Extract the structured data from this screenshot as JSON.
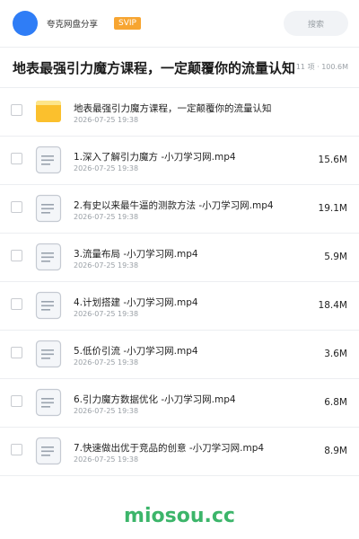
{
  "header": {
    "app_name": "夸克网盘分享",
    "badge": "SVIP",
    "search_label": "搜索"
  },
  "folder": {
    "title": "地表最强引力魔方课程，一定颠覆你的流量认知",
    "meta": "11 项 · 100.6M"
  },
  "items": [
    {
      "type": "folder",
      "name": "地表最强引力魔方课程，一定颠覆你的流量认知",
      "date": "2026-07-25 19:38",
      "size": ""
    },
    {
      "type": "file",
      "name": "1.深入了解引力魔方 -小刀学习网.mp4",
      "date": "2026-07-25 19:38",
      "size": "15.6M"
    },
    {
      "type": "file",
      "name": "2.有史以来最牛逼的测款方法 -小刀学习网.mp4",
      "date": "2026-07-25 19:38",
      "size": "19.1M"
    },
    {
      "type": "file",
      "name": "3.流量布局 -小刀学习网.mp4",
      "date": "2026-07-25 19:38",
      "size": "5.9M"
    },
    {
      "type": "file",
      "name": "4.计划搭建 -小刀学习网.mp4",
      "date": "2026-07-25 19:38",
      "size": "18.4M"
    },
    {
      "type": "file",
      "name": "5.低价引流 -小刀学习网.mp4",
      "date": "2026-07-25 19:38",
      "size": "3.6M"
    },
    {
      "type": "file",
      "name": "6.引力魔方数据优化 -小刀学习网.mp4",
      "date": "2026-07-25 19:38",
      "size": "6.8M"
    },
    {
      "type": "file",
      "name": "7.快速做出优于竞品的创意 -小刀学习网.mp4",
      "date": "2026-07-25 19:38",
      "size": "8.9M"
    }
  ],
  "watermark": "miosou.cc",
  "colors": {
    "accent": "#2f7df6",
    "svip": "#f7a531",
    "folder": "#fbc02d",
    "watermark": "#3cb56a"
  },
  "icons": {
    "logo": "avatar-circle",
    "folder": "folder-icon",
    "file": "document-icon"
  }
}
